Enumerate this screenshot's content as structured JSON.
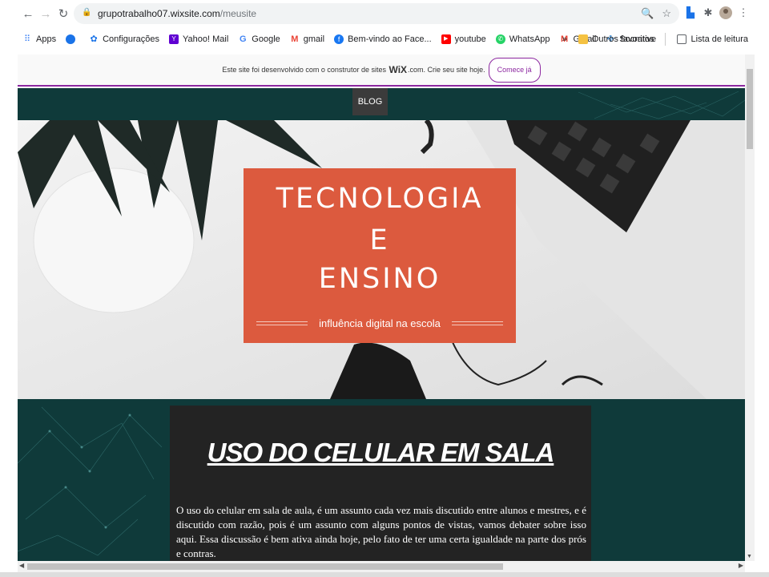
{
  "browser": {
    "url_host": "grupotrabalho07.wixsite.com",
    "url_path": "/meusite",
    "bookmarks": [
      {
        "label": "Apps",
        "icon": "apps-grid-icon"
      },
      {
        "label": "",
        "icon": "globe-icon"
      },
      {
        "label": "Configurações",
        "icon": "settings-gear-icon"
      },
      {
        "label": "Yahoo! Mail",
        "icon": "yahoo-icon"
      },
      {
        "label": "Google",
        "icon": "google-icon"
      },
      {
        "label": "gmail",
        "icon": "gmail-icon"
      },
      {
        "label": "Bem-vindo ao Face...",
        "icon": "facebook-icon"
      },
      {
        "label": "youtube",
        "icon": "youtube-icon"
      },
      {
        "label": "WhatsApp",
        "icon": "whatsapp-icon"
      },
      {
        "label": "Gmail",
        "icon": "gmail-icon"
      },
      {
        "label": "Socrative",
        "icon": "socrative-icon"
      }
    ],
    "more_glyph": "»",
    "other_favorites": "Outros favoritos",
    "reading_list": "Lista de leitura"
  },
  "wix_banner": {
    "text_before": "Este site foi desenvolvido com o construtor de sites",
    "brand": "WiX",
    "text_after": ".com. Crie seu site hoje.",
    "cta": "Comece já"
  },
  "nav": {
    "blog": "BLOG"
  },
  "hero": {
    "line1": "TECNOLOGIA",
    "line2": "E",
    "line3": "ENSINO",
    "subtitle": "influência digital na escola"
  },
  "article": {
    "title": "USO DO CELULAR EM SALA",
    "body": "O uso do celular em sala de aula, é um assunto cada vez mais discutido entre alunos e mestres, e é discutido com razão, pois é um assunto com alguns pontos de vistas, vamos debater sobre isso aqui. Essa discussão é bem ativa ainda hoje, pelo fato de ter uma certa igualdade na parte dos prós e contras."
  },
  "colors": {
    "accent_orange": "#dc5a3e",
    "dark_teal": "#0f3a3a",
    "wix_purple": "#8c27a0",
    "article_bg": "#232323"
  }
}
